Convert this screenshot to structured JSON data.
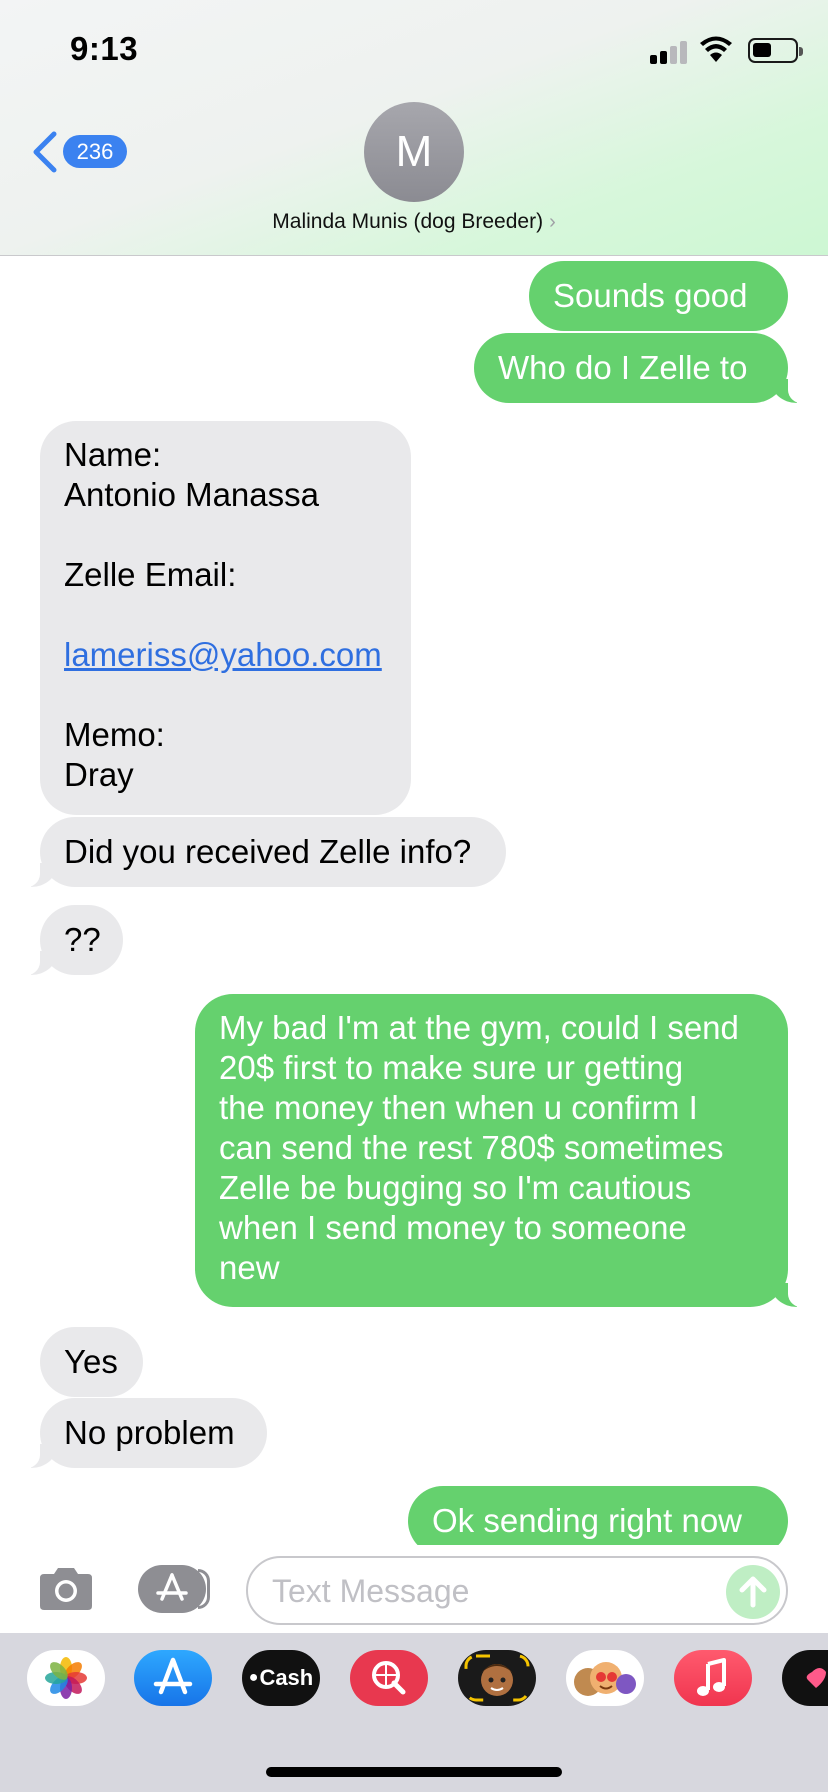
{
  "status_bar": {
    "time": "9:13"
  },
  "header": {
    "back_badge": "236",
    "avatar_initial": "M",
    "contact_name": "Malinda Munis (dog Breeder)",
    "chevron": "›"
  },
  "messages": [
    {
      "from": "me",
      "text": "Sounds good"
    },
    {
      "from": "me",
      "text": "Who do I Zelle to"
    },
    {
      "from": "them",
      "lines": [
        "Name:",
        "Antonio Manassa",
        "",
        "Zelle Email:",
        "",
        "lameriss@yahoo.com",
        "",
        "Memo:",
        "Dray"
      ]
    },
    {
      "from": "them",
      "text": "Did you received Zelle info?"
    },
    {
      "from": "them",
      "text": "??"
    },
    {
      "from": "me",
      "lines": [
        "My bad I'm at the gym, could I send",
        "20$ first to make sure ur getting",
        "the money then when u confirm I",
        "can send the rest 780$ sometimes",
        "Zelle be bugging so I'm cautious",
        "when I send money to someone",
        "new"
      ]
    },
    {
      "from": "them",
      "text": "Yes"
    },
    {
      "from": "them",
      "text": "No problem"
    },
    {
      "from": "me",
      "text": "Ok sending right now"
    }
  ],
  "input": {
    "placeholder": "Text Message"
  },
  "app_drawer": {
    "apps": [
      "photos-icon",
      "app-store-icon",
      "apple-cash-icon",
      "images-search-icon",
      "memoji-icon",
      "animoji-icon",
      "music-icon",
      "digital-touch-icon"
    ],
    "cash_label": "Cash"
  },
  "colors": {
    "sent_bubble": "#65d16e",
    "received_bubble": "#e9e9eb",
    "link": "#2f6fe0",
    "accent": "#3b82f0"
  }
}
